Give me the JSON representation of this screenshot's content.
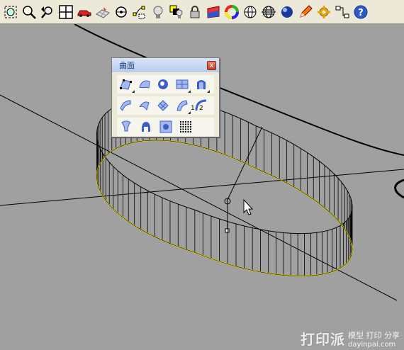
{
  "toolbar": {
    "buttons": [
      {
        "name": "zoom-extents-icon"
      },
      {
        "name": "zoom-window-icon"
      },
      {
        "name": "undo-view-icon"
      },
      {
        "name": "four-viewports-icon"
      },
      {
        "name": "car-icon"
      },
      {
        "name": "plane-grid-icon"
      },
      {
        "name": "camera-target-icon"
      },
      {
        "name": "point-edit-icon"
      },
      {
        "name": "light-bulb-icon"
      },
      {
        "name": "layer-bulb-icon"
      },
      {
        "name": "lock-icon"
      },
      {
        "name": "shade-object-icon"
      },
      {
        "name": "color-wheel-icon"
      },
      {
        "name": "wireframe-sphere-icon"
      },
      {
        "name": "globe-grid-icon"
      },
      {
        "name": "render-sphere-icon"
      },
      {
        "name": "pencil-icon"
      },
      {
        "name": "settings-gear-icon"
      },
      {
        "name": "workflow-icon"
      },
      {
        "name": "help-icon"
      }
    ]
  },
  "surface_panel": {
    "title": "曲面",
    "close_label": "x",
    "rows": [
      [
        "surface-from-points-icon",
        "surface-edge-icon",
        "surface-patch-icon",
        "surface-plane-icon",
        "surface-extrude-icon"
      ],
      [
        "surface-loft-icon",
        "surface-sweep-icon",
        "surface-network-icon",
        "surface-sweep-2rail-icon",
        ""
      ],
      [
        "surface-revolve-icon",
        "surface-rail-revolve-icon",
        "surface-heightfield-icon",
        "surface-grid-points-icon"
      ]
    ],
    "row2_label_1": "1",
    "row2_label_2": "2"
  },
  "watermark": {
    "logo": "打印派",
    "cn": "模型 打印 分享",
    "url": "dayinpai.com"
  },
  "colors": {
    "viewport_bg": "#a0a0a0",
    "curve_yellow": "#f0e000",
    "mesh_black": "#000000"
  }
}
